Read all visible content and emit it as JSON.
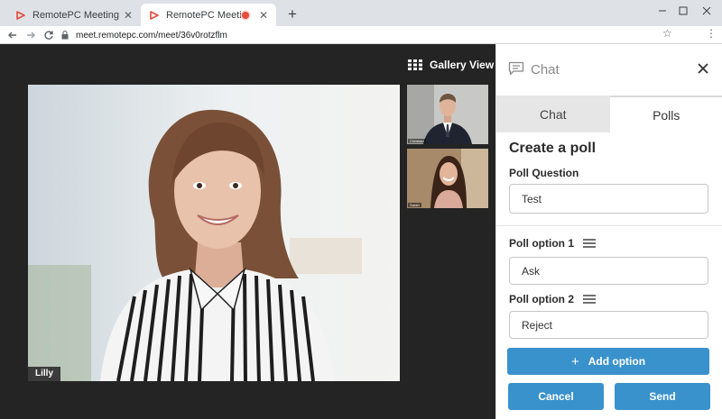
{
  "browser": {
    "tabs": [
      {
        "title": "RemotePC Meeting",
        "active": false
      },
      {
        "title": "RemotePC Meeting",
        "active": true,
        "recording": true
      }
    ],
    "url": "meet.remotepc.com/meet/36v0rotzflm",
    "accent": "#e74c3c"
  },
  "meeting": {
    "gallery_label": "Gallery View",
    "main_participant": "Lilly",
    "thumbnails": [
      {
        "name": "Christian"
      },
      {
        "name": "Sarah"
      }
    ]
  },
  "panel": {
    "title": "Chat",
    "tabs": [
      {
        "label": "Chat",
        "active": false
      },
      {
        "label": "Polls",
        "active": true
      }
    ],
    "poll": {
      "heading": "Create a poll",
      "question_label": "Poll Question",
      "question_value": "Test",
      "options": [
        {
          "label": "Poll option 1",
          "value": "Ask"
        },
        {
          "label": "Poll option 2",
          "value": "Reject"
        }
      ],
      "add_option_label": "Add option",
      "cancel_label": "Cancel",
      "send_label": "Send"
    },
    "button_color": "#3a92cc"
  }
}
